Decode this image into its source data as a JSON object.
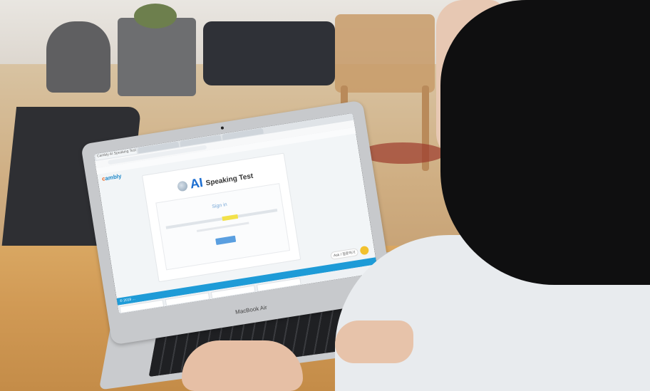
{
  "laptop": {
    "brand": "MacBook Air"
  },
  "browser": {
    "tabs": [
      "Cambly AI Speaking Test",
      "",
      "",
      ""
    ],
    "bookmarks": [
      "",
      "",
      "",
      "",
      ""
    ]
  },
  "page": {
    "logo_prefix": "c",
    "logo_rest": "ambly",
    "title_ai": "AI",
    "title_rest": "Speaking Test",
    "signin": "Sign in",
    "button": "",
    "footer": "© 2019 ...",
    "helper_label": "Ask / 질문하기",
    "dock": [
      "",
      "",
      "",
      ""
    ]
  },
  "colors": {
    "accent_blue": "#1e6fd1",
    "footer_blue": "#1e9bd7",
    "highlight_yellow": "#f2e14a"
  }
}
